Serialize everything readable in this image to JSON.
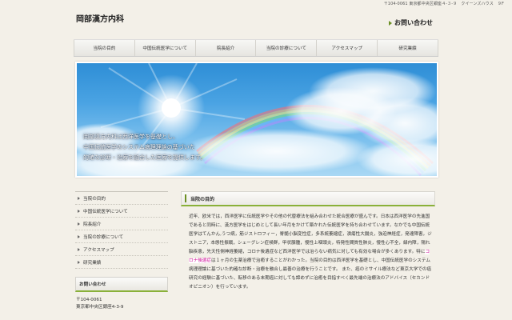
{
  "header": {
    "address": "〒104-0061 東京都中央区銀座４-３-９　クイーンズハウス　９F",
    "logo": "岡部漢方内科",
    "contact": "お問い合わせ"
  },
  "nav": {
    "items": [
      {
        "label": "当院の目的"
      },
      {
        "label": "中国伝統医学について"
      },
      {
        "label": "院長紹介"
      },
      {
        "label": "当院の診療について"
      },
      {
        "label": "アクセスマップ"
      },
      {
        "label": "研究業績"
      }
    ]
  },
  "hero": {
    "lines": [
      "岡部漢方内科は西洋医学を基礎とし、",
      "中国伝統医学のシステム病理理論の基づいた",
      "的確な診断・治療を融合した医療を提供します。"
    ]
  },
  "sidebar": {
    "items": [
      {
        "label": "当院の目的"
      },
      {
        "label": "中国伝統医学について"
      },
      {
        "label": "院長紹介"
      },
      {
        "label": "当院の診療について"
      },
      {
        "label": "アクセスマップ"
      },
      {
        "label": "研究業績"
      }
    ],
    "contact_title": "お問い合わせ",
    "postal": "〒104-0061",
    "address": "東京都中央区銀座4-3-9"
  },
  "main": {
    "heading": "当院の目的",
    "text_before": "近年、欧米では，西洋医学に伝統医学やその他の代替療法を組み合わせた統合医療が盛んです。日本は西洋医学の先進国であると同時に、漢方医学をはじめとして長い年月をかけて築かれた伝統医学を持ち合わせています。なかでも中国伝統医学はてんかん,うつ病，筋ジストロフィー，脊髄小脳変性症，多系統萎縮症，潰瘍性大腸炎，強迫神経症，発達障害，ジストニア，本態性振戦，シェーグレン症候群，甲状腺腫，慢性上咽頭炎，特発性間質性肺炎，慢性心不全，緑内障，陽れ脳疾患，先天性側神経萎縮，コロナ後遺症など西洋医学では治らない病気に対しても有効な場合が多くあります。特に",
    "highlight": "コロナ後遺症",
    "text_after": "は１ヶ月の生薬治療で治癒することがわかった。当院の目的は西洋医学を基礎とし、中国伝統医学のシステム病理理論に基づいた的確な診断・治療を融合し最善の治療を行うことです。 また、癌のミサイル療法など東京大学での癌研究の経験に基づいた、転移のある末期癌に対しても諦めずに治癒を目指すべく最先端の治療法のアドバイス（セカンドオピニオン）を行っています。"
  },
  "colors": {
    "accent": "#8ab13a",
    "arrow": "#6b8f23",
    "highlight_text": "#d0119a",
    "background": "#f3f0e8"
  }
}
